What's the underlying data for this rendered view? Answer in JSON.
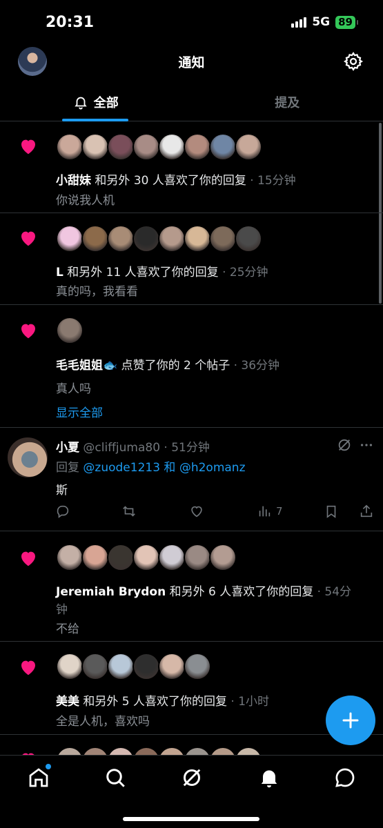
{
  "status": {
    "time": "20:31",
    "network": "5G",
    "battery": "89"
  },
  "header": {
    "title": "通知",
    "avatar": "profile-avatar",
    "settings_icon": "gear-icon"
  },
  "tabs": [
    {
      "label": "全部",
      "icon": "bell-icon",
      "active": true
    },
    {
      "label": "提及",
      "active": false
    }
  ],
  "notifications": [
    {
      "type": "like",
      "icon": "heart-icon",
      "avatar_colors": [
        "#caa89a",
        "#d9c2b3",
        "#7a4e5a",
        "#a88c86",
        "#e8e8e8",
        "#b38b7e",
        "#6f86a5",
        "#c7a899"
      ],
      "actor": "小甜妹",
      "text": " 和另外 30 人喜欢了你的回复",
      "time": " · 15分钟",
      "snippet": "你说我人机"
    },
    {
      "type": "like",
      "icon": "heart-icon",
      "avatar_colors": [
        "#f0c6e0",
        "#8c6a4a",
        "#a88c76",
        "#2a2a2a",
        "#b59a8c",
        "#d7b897",
        "#7d6a5a",
        "#4a4a4a"
      ],
      "actor": "L",
      "text": " 和另外 11 人喜欢了你的回复",
      "time": " · 25分钟",
      "snippet": "真的吗，我看看"
    },
    {
      "type": "like",
      "icon": "heart-icon",
      "avatar_colors": [
        "#8a7a70"
      ],
      "actor": "毛毛姐姐🐟",
      "text": " 点赞了你的 2 个帖子",
      "time": " · 36分钟",
      "snippet": "真人吗",
      "show_all": "显示全部"
    }
  ],
  "post": {
    "name": "小夏",
    "handle": " @cliffjuma80",
    "time": " · 51分钟",
    "reply_prefix": "回复 ",
    "reply_to": "@zuode1213 和 @h2omanz",
    "body": "斯",
    "views": "7",
    "icons": [
      "grok-icon",
      "more-icon",
      "reply-icon",
      "retweet-icon",
      "like-icon",
      "views-icon",
      "bookmark-icon",
      "share-icon"
    ]
  },
  "notifications2": [
    {
      "type": "like",
      "icon": "heart-icon",
      "avatar_colors": [
        "#c4b0a6",
        "#d8a594",
        "#3a3530",
        "#e2c4b6",
        "#d0ccd4",
        "#9a8a84",
        "#b39c92"
      ],
      "actor": "Jeremiah Brydon",
      "text": " 和另外 6 人喜欢了你的回复",
      "time": " · 54分",
      "time_wrap": "钟",
      "snippet": "不给"
    },
    {
      "type": "like",
      "icon": "heart-icon",
      "avatar_colors": [
        "#e0d4c8",
        "#5a5a5a",
        "#b8c8d8",
        "#2e2e2e",
        "#d6b8a8",
        "#8a8e92"
      ],
      "actor": "美美",
      "text": " 和另外 5 人喜欢了你的回复",
      "time": " · 1小时",
      "snippet": "全是人机，喜欢吗"
    }
  ],
  "fab": {
    "icon": "plus-icon"
  },
  "bottom_nav": [
    "home-icon",
    "search-icon",
    "grok-icon",
    "bell-icon",
    "messages-icon"
  ],
  "colors": {
    "accent": "#1d9bf0",
    "heart": "#f91880",
    "background": "#000000"
  }
}
